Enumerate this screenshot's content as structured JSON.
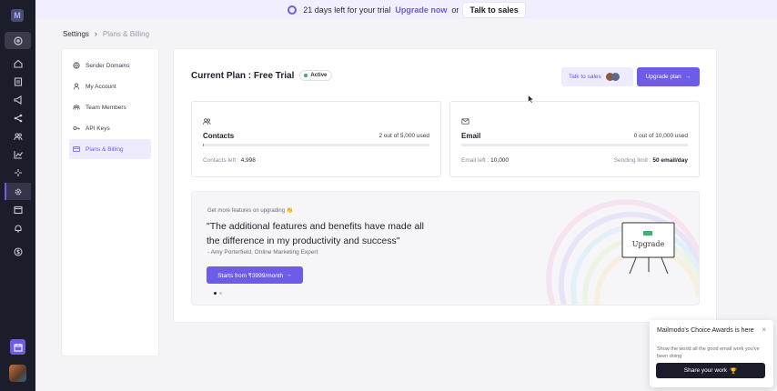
{
  "rail": {
    "logo_text": "M",
    "icons": [
      "circle-plus-icon",
      "home-icon",
      "list-icon",
      "megaphone-icon",
      "share-icon",
      "users-icon",
      "chart-icon",
      "sparkle-icon",
      "gear-icon",
      "window-icon",
      "bell-icon",
      "dollar-icon"
    ],
    "active_icon": "gear-icon"
  },
  "banner": {
    "trial_text": "21 days left for your trial",
    "upgrade_link": "Upgrade now",
    "or_text": "or",
    "talk_button": "Talk to sales"
  },
  "breadcrumb": {
    "root": "Settings",
    "current": "Plans & Billing"
  },
  "sidenav": {
    "items": [
      {
        "label": "Sender Domains",
        "icon": "globe-icon"
      },
      {
        "label": "My Account",
        "icon": "user-icon"
      },
      {
        "label": "Team Members",
        "icon": "team-icon"
      },
      {
        "label": "API Keys",
        "icon": "key-icon"
      },
      {
        "label": "Plans & Billing",
        "icon": "card-icon"
      }
    ],
    "active_index": 4
  },
  "plan": {
    "title": "Current Plan : Free Trial",
    "status": "Active",
    "talk_button": "Talk to sales",
    "upgrade_button": "Upgrade plan",
    "upgrade_arrow": "→"
  },
  "stats": {
    "contacts": {
      "name": "Contacts",
      "used": "2 out of 5,000 used",
      "used_fraction": 0.0004,
      "left_label": "Contacts left :",
      "left_value": "4,998"
    },
    "email": {
      "name": "Email",
      "used": "0 out of 10,000 used",
      "used_fraction": 0,
      "left_label": "Email left :",
      "left_value": "10,000",
      "limit_label": "Sending limit :",
      "limit_value": "50 email/day"
    }
  },
  "upsell": {
    "small_text": "Get more features on upgrading 👏",
    "quote": "\"The additional features and benefits have made all the difference in my productivity and success\"",
    "author": "- Amy Porterfield, Online Marketing Expert",
    "cta": "Starts from ₹3999/month",
    "cta_arrow": "→",
    "board_text": "Upgrade",
    "slides": 2,
    "current_slide": 0
  },
  "toast": {
    "title": "Mailmodo's Choice Awards is here",
    "desc": "Show the world all the good email work you've been doing",
    "button": "Share your work",
    "button_emoji": "🏆",
    "close": "×"
  },
  "colors": {
    "accent": "#6c5ce7",
    "rail_bg": "#1c1d2b",
    "active_green": "#2fb36b"
  }
}
